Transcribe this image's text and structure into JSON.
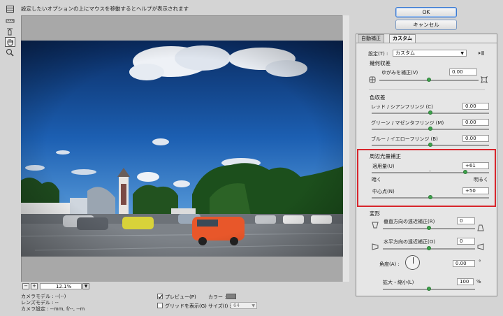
{
  "hint": "設定したいオプションの上にマウスを移動するとヘルプが表示されます",
  "buttons": {
    "ok": "OK",
    "cancel": "キャンセル"
  },
  "tabs": [
    {
      "label": "自動補正"
    },
    {
      "label": "カスタム"
    }
  ],
  "settings": {
    "label": "設定(T) :",
    "value": "カスタム"
  },
  "geometric": {
    "title": "幾何収差",
    "remove_distortion": {
      "label": "ゆがみを補正(V)",
      "value": "0.00",
      "level": 0.5
    }
  },
  "chromatic": {
    "title": "色収差",
    "items": [
      {
        "label": "レッド / シアンフリンジ (C)",
        "value": "0.00",
        "level": 0.5
      },
      {
        "label": "グリーン / マゼンタフリンジ (M)",
        "value": "0.00",
        "level": 0.5
      },
      {
        "label": "ブルー / イエローフリンジ (B)",
        "value": "0.00",
        "level": 0.5
      }
    ]
  },
  "vignette": {
    "title": "周辺光量補正",
    "amount": {
      "label": "適用量(U)",
      "value": "+61",
      "level": 0.8
    },
    "darken": "暗く",
    "lighten": "明るく",
    "midpoint": {
      "label": "中心点(N)",
      "value": "+50",
      "level": 0.5
    }
  },
  "transform": {
    "title": "変形",
    "vertical": {
      "label": "垂直方向の遠近補正(R)",
      "value": "0",
      "level": 0.5
    },
    "horizontal": {
      "label": "水平方向の遠近補正(O)",
      "value": "0",
      "level": 0.5
    },
    "angle": {
      "label": "角度(A) :",
      "value": "0.00",
      "unit": "°"
    },
    "scale": {
      "label": "拡大・縮小(L)",
      "value": "100",
      "unit": "%",
      "level": 0.5
    }
  },
  "zoom": {
    "value": "12.1%",
    "minus": "−",
    "plus": "+"
  },
  "camera_info": {
    "camera_model": "カメラモデル : --(--)",
    "lens_model": "レンズモデル : --",
    "camera_settings": "カメラ設定 : --mm, f/--, --m"
  },
  "preview_option": "プレビュー(P)",
  "grid_option": "グリッドを表示(G)",
  "color_label": "カラー :",
  "size_label": "サイズ(I) :",
  "size_value": "64",
  "colors": {
    "accent": "#3da24b",
    "highlight": "#d8262c",
    "swatch": "#7f7f7f"
  }
}
